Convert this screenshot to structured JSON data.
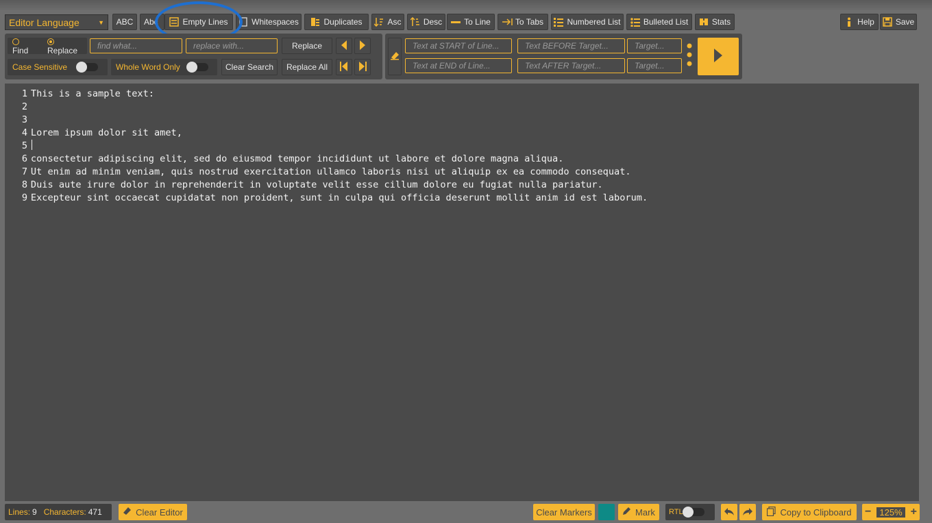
{
  "toolbar": {
    "language_select": "Editor Language",
    "abc": "ABC",
    "abc_lower": "Abc",
    "empty_lines": "Empty Lines",
    "whitespaces": "Whitespaces",
    "duplicates": "Duplicates",
    "asc": "Asc",
    "desc": "Desc",
    "to_line": "To Line",
    "to_tabs": "To Tabs",
    "numbered_list": "Numbered List",
    "bulleted_list": "Bulleted List",
    "stats": "Stats",
    "help": "Help",
    "save": "Save"
  },
  "search": {
    "find_label": "Find",
    "replace_label": "Replace",
    "find_placeholder": "find what...",
    "replace_placeholder": "replace with...",
    "replace_button": "Replace",
    "case_sensitive": "Case Sensitive",
    "whole_word": "Whole Word Only",
    "clear_search": "Clear Search",
    "replace_all": "Replace All"
  },
  "insert": {
    "start_placeholder": "Text at START of Line...",
    "end_placeholder": "Text at END of Line...",
    "before_placeholder": "Text BEFORE Target...",
    "after_placeholder": "Text AFTER Target...",
    "target_placeholder_1": "Target...",
    "target_placeholder_2": "Target..."
  },
  "editor": {
    "lines": [
      {
        "num": "1",
        "text": "This is a sample text:"
      },
      {
        "num": "2",
        "text": ""
      },
      {
        "num": "3",
        "text": ""
      },
      {
        "num": "4",
        "text": "Lorem ipsum dolor sit amet,"
      },
      {
        "num": "5",
        "text": ""
      },
      {
        "num": "6",
        "text": "consectetur adipiscing elit, sed do eiusmod tempor incididunt ut labore et dolore magna aliqua."
      },
      {
        "num": "7",
        "text": "Ut enim ad minim veniam, quis nostrud exercitation ullamco laboris nisi ut aliquip ex ea commodo consequat."
      },
      {
        "num": "8",
        "text": "Duis aute irure dolor in reprehenderit in voluptate velit esse cillum dolore eu fugiat nulla pariatur."
      },
      {
        "num": "9",
        "text": "Excepteur sint occaecat cupidatat non proident, sunt in culpa qui officia deserunt mollit anim id est laborum."
      }
    ]
  },
  "status": {
    "lines_label": "Lines:",
    "lines_value": "9",
    "chars_label": "Characters:",
    "chars_value": "471",
    "clear_editor": "Clear Editor",
    "clear_markers": "Clear Markers",
    "mark": "Mark",
    "rtl": "RTL",
    "copy": "Copy to Clipboard",
    "zoom": "125%"
  },
  "colors": {
    "accent": "#f5b731",
    "marker": "#0e8a86",
    "highlight_ring": "#1e6fd0"
  }
}
